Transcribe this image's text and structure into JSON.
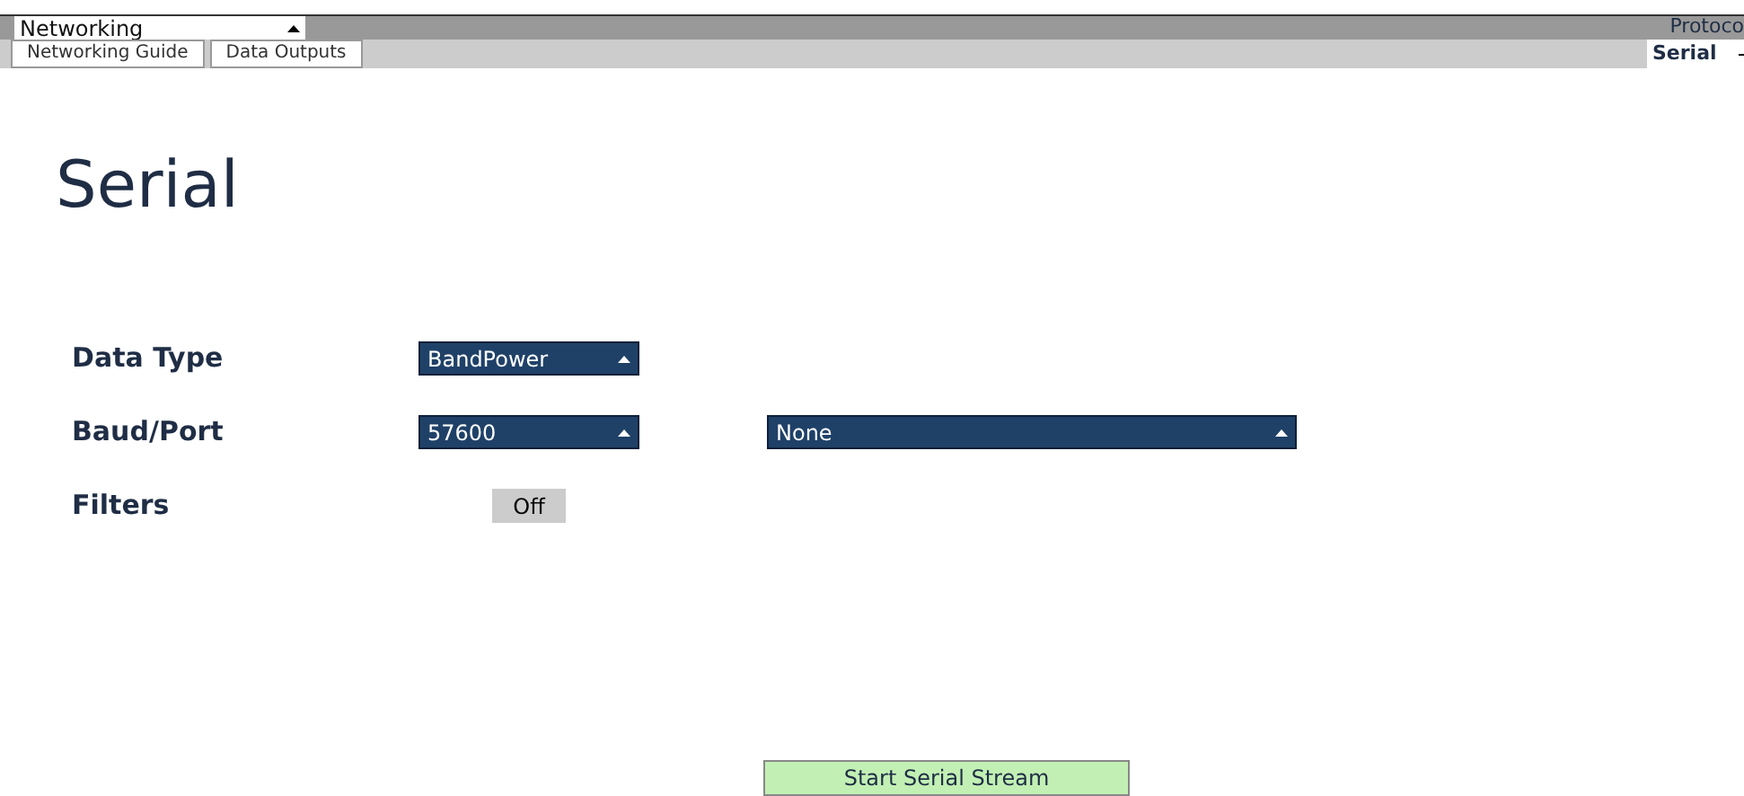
{
  "top_bar": {
    "widget_dropdown": "Networking",
    "protocol_label": "Protoco",
    "protocol_dropdown": "Serial"
  },
  "tabs": [
    {
      "label": "Networking Guide"
    },
    {
      "label": "Data Outputs"
    }
  ],
  "heading": "Serial",
  "settings": [
    {
      "label": "Data Type",
      "kind": "dropdown",
      "value": "BandPower"
    },
    {
      "label": "Baud/Port",
      "kind": "dropdown_pair",
      "value": "57600",
      "port": "None"
    },
    {
      "label": "Filters",
      "kind": "toggle",
      "value": "Off"
    }
  ],
  "start_button": "Start Serial Stream"
}
